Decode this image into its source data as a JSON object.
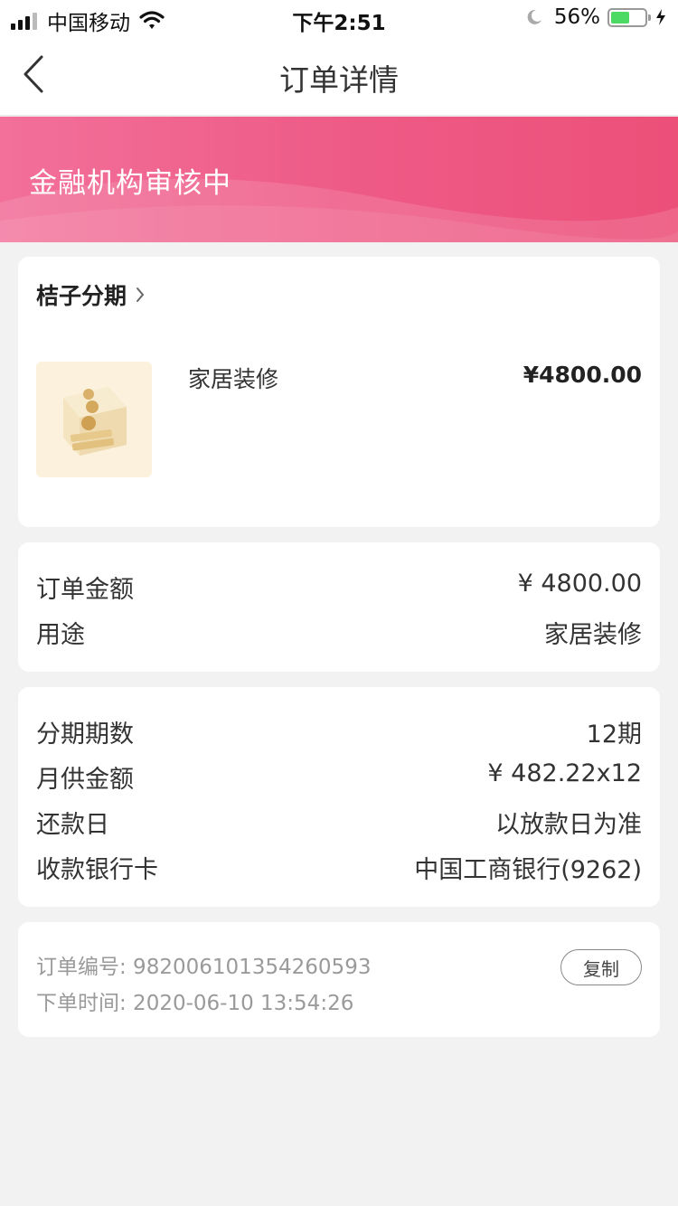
{
  "status_bar": {
    "carrier": "中国移动",
    "time": "下午2:51",
    "battery_percent": "56%",
    "battery_level": 0.56
  },
  "nav": {
    "title": "订单详情",
    "back_icon": "chevron-left-icon"
  },
  "banner": {
    "status_text": "金融机构审核中",
    "accent_color": "#ee5b87"
  },
  "product": {
    "merchant": "桔子分期",
    "name": "家居装修",
    "price": "¥4800.00",
    "image_icon": "coin-box-icon"
  },
  "order_info": {
    "rows": [
      {
        "label": "订单金额",
        "value": "¥ 4800.00"
      },
      {
        "label": "用途",
        "value": "家居装修"
      }
    ]
  },
  "installment_info": {
    "rows": [
      {
        "label": "分期期数",
        "value": "12期"
      },
      {
        "label": "月供金额",
        "value": "¥ 482.22x12"
      },
      {
        "label": "还款日",
        "value": "以放款日为准"
      },
      {
        "label": "收款银行卡",
        "value": "中国工商银行(9262)"
      }
    ]
  },
  "order_meta": {
    "order_number": "订单编号: 982006101354260593",
    "order_time": "下单时间: 2020-06-10 13:54:26",
    "copy_label": "复制"
  }
}
